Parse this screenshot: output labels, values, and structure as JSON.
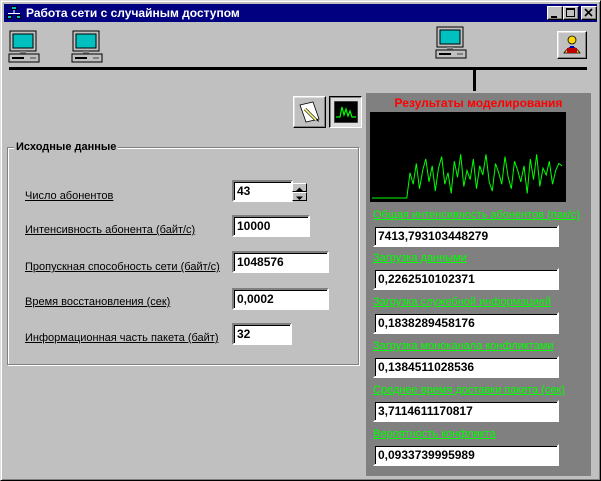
{
  "window": {
    "title": "Работа сети с случайным доступом"
  },
  "colors": {
    "titlebar": "#000080",
    "results_title": "#ff0000",
    "results_labels": "#00ff00",
    "chart_line": "#00ff00",
    "results_bg": "#808080"
  },
  "inputs": {
    "legend": "Исходные данные",
    "fields": [
      {
        "label": "Число абонентов",
        "value": "43"
      },
      {
        "label": "Интенсивность абонента (байт/с)",
        "value": "10000"
      },
      {
        "label": "Пропускная способность сети (байт/с)",
        "value": "1048576"
      },
      {
        "label": "Время восстановления (сек)",
        "value": "0,0002"
      },
      {
        "label": "Информационная часть пакета (байт)",
        "value": "32"
      }
    ]
  },
  "results": {
    "title": "Результаты моделирования",
    "items": [
      {
        "label": "Общая интенсивность абонентов (пак/с)",
        "value": "7413,793103448279"
      },
      {
        "label": "Загрузка данными",
        "value": "0,2262510102371"
      },
      {
        "label": "Загрузка служебной информацией",
        "value": "0,1838289458176"
      },
      {
        "label": "Загрузка моноканала конфликтами",
        "value": "0,1384511028536"
      },
      {
        "label": "Среднее время доставки пакета (сек)",
        "value": "3,7114611170817"
      },
      {
        "label": "Вероятность конфликта",
        "value": "0,0933739995989"
      }
    ]
  },
  "chart_data": {
    "type": "line",
    "x": [
      0,
      1,
      2,
      3,
      4,
      5,
      6,
      7,
      8,
      9,
      10,
      11,
      12,
      13,
      14,
      15,
      16,
      17,
      18,
      19,
      20,
      21,
      22,
      23,
      24,
      25,
      26,
      27,
      28,
      29,
      30,
      31,
      32,
      33,
      34,
      35,
      36,
      37,
      38,
      39,
      40,
      41,
      42,
      43,
      44,
      45,
      46,
      47,
      48,
      49,
      50,
      51,
      52,
      53,
      54,
      55,
      56,
      57,
      58,
      59,
      60
    ],
    "values": [
      0,
      0,
      0,
      0,
      0,
      0,
      0,
      0,
      0,
      0,
      0,
      0,
      0.55,
      0.3,
      0.75,
      0.2,
      0.6,
      0.85,
      0.35,
      0.7,
      0.15,
      0.65,
      0.9,
      0.3,
      0.55,
      0.1,
      0.8,
      0.45,
      0.95,
      0.25,
      0.6,
      0.4,
      0.85,
      0.2,
      0.7,
      0.5,
      0.95,
      0.35,
      0.15,
      0.75,
      0.55,
      0.3,
      0.9,
      0.45,
      0.2,
      0.8,
      0.6,
      0.35,
      0.7,
      0.1,
      0.85,
      0.4,
      0.95,
      0.25,
      0.65,
      0.5,
      0.8,
      0.3,
      0.6,
      0.75,
      0.7
    ],
    "ylim": [
      0,
      1
    ]
  }
}
